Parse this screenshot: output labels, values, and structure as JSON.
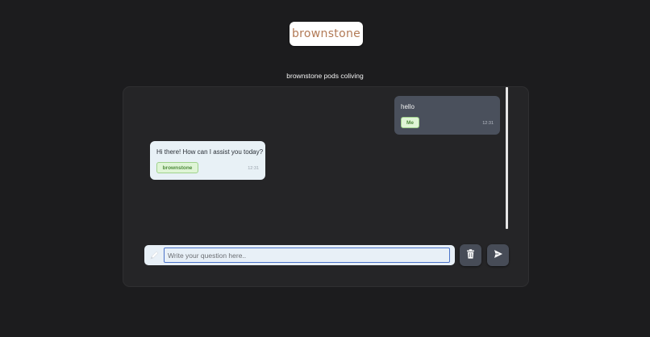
{
  "header": {
    "logo_text": "brownstone",
    "subtitle": "brownstone pods coliving"
  },
  "messages": [
    {
      "role": "user",
      "text": "hello",
      "sender": "Me",
      "time": "12:31"
    },
    {
      "role": "bot",
      "text": "Hi there! How can I assist you today?",
      "sender": "brownstone",
      "time": "12:31"
    }
  ],
  "composer": {
    "placeholder": "Write your question here..",
    "value": "",
    "icons": {
      "input": "pencil-icon",
      "clear": "trash-icon",
      "send": "send-icon"
    }
  },
  "colors": {
    "background": "#1c1c1e",
    "panel": "#252527",
    "user_bubble": "#4a505c",
    "bot_bubble": "#e8f1f6",
    "tag_bg": "#dff5d6",
    "tag_text": "#4d8a3b",
    "logo_text": "#b27a56",
    "button": "#474c57"
  }
}
